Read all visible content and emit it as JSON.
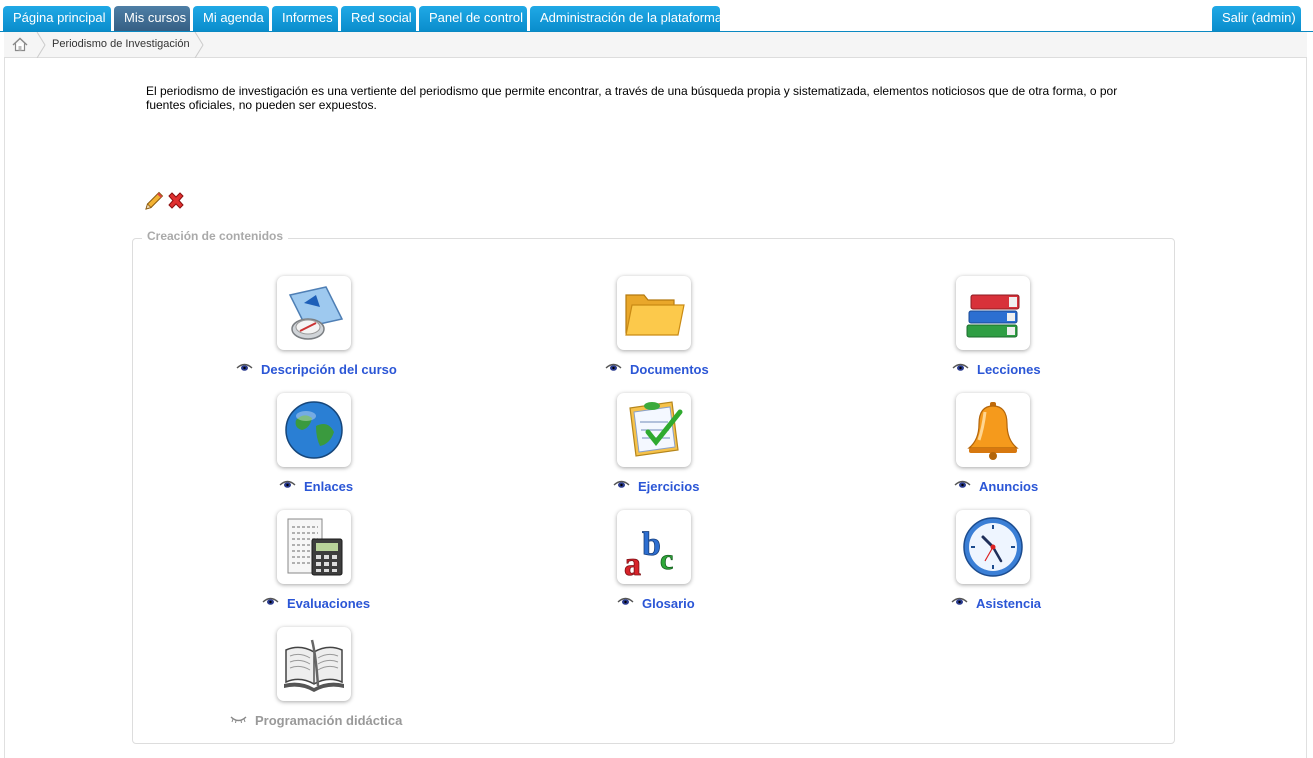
{
  "nav": {
    "tabs": [
      "Página principal",
      "Mis cursos",
      "Mi agenda",
      "Informes",
      "Red social",
      "Panel de control",
      "Administración de la plataforma"
    ],
    "active": "Mis cursos",
    "logout": "Salir (admin)"
  },
  "breadcrumb": {
    "current": "Periodismo de Investigación"
  },
  "course": {
    "intro": "El periodismo de investigación es una vertiente del periodismo que permite encontrar, a través de una búsqueda propia y sistematizada, elementos noticiosos que de otra forma, o por fuentes oficiales, no pueden ser expuestos."
  },
  "section": {
    "title": "Creación de contenidos"
  },
  "tools": [
    {
      "label": "Descripción del curso",
      "icon": "course-description-icon",
      "visible": true
    },
    {
      "label": "Documentos",
      "icon": "folder-icon",
      "visible": true
    },
    {
      "label": "Lecciones",
      "icon": "books-icon",
      "visible": true
    },
    {
      "label": "Enlaces",
      "icon": "globe-icon",
      "visible": true
    },
    {
      "label": "Ejercicios",
      "icon": "checklist-icon",
      "visible": true
    },
    {
      "label": "Anuncios",
      "icon": "bell-icon",
      "visible": true
    },
    {
      "label": "Evaluaciones",
      "icon": "calculator-icon",
      "visible": true
    },
    {
      "label": "Glosario",
      "icon": "abc-icon",
      "visible": true
    },
    {
      "label": "Asistencia",
      "icon": "clock-icon",
      "visible": true
    },
    {
      "label": "Programación didáctica",
      "icon": "open-book-icon",
      "visible": false
    }
  ],
  "colors": {
    "tab": "#0a8dcc",
    "tab_active": "#365f84",
    "link": "#2b56d6",
    "disabled": "#999999"
  }
}
